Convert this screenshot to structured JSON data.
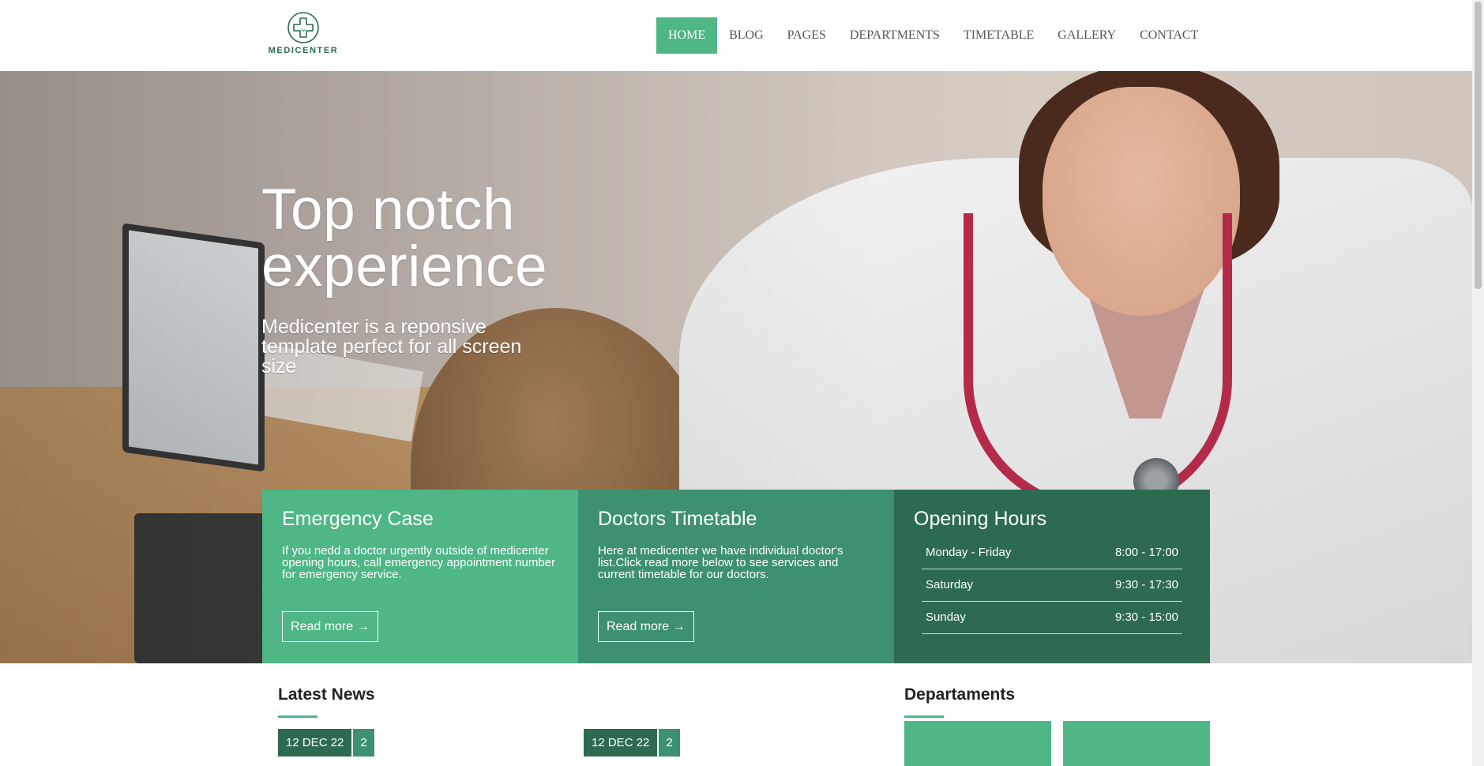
{
  "brand": {
    "logo_text": "MEDICENTER",
    "logo_icon": "medical-cross-icon",
    "accent_color": "#4fb785",
    "dark_color": "#2d6b51",
    "mid_color": "#3d9170"
  },
  "nav": {
    "items": [
      {
        "label": "HOME",
        "active": true
      },
      {
        "label": "BLOG",
        "active": false
      },
      {
        "label": "PAGES",
        "active": false
      },
      {
        "label": "DEPARTMENTS",
        "active": false
      },
      {
        "label": "TIMETABLE",
        "active": false
      },
      {
        "label": "GALLERY",
        "active": false
      },
      {
        "label": "CONTACT",
        "active": false
      }
    ]
  },
  "hero": {
    "title_line1": "Top notch",
    "title_line2": "experience",
    "subtitle": "Medicenter is a reponsive template perfect for all screen size"
  },
  "boxes": {
    "emergency": {
      "title": "Emergency Case",
      "text": "If you nedd a doctor urgently outside of medicenter opening hours, call emergency appointment number for emergency service.",
      "button": "Read more →"
    },
    "timetable": {
      "title": "Doctors Timetable",
      "text": "Here at medicenter we have individual doctor's list.Click read more below to see services and current timetable for our doctors.",
      "button": "Read more →"
    },
    "hours": {
      "title": "Opening Hours",
      "rows": [
        {
          "day": "Monday - Friday",
          "time": "8:00 - 17:00"
        },
        {
          "day": "Saturday",
          "time": "9:30 - 17:30"
        },
        {
          "day": "Sunday",
          "time": "9:30 - 15:00"
        }
      ]
    }
  },
  "news": {
    "title": "Latest News",
    "items": [
      {
        "date": "12 DEC 22",
        "comments": "2"
      },
      {
        "date": "12 DEC 22",
        "comments": "2"
      }
    ]
  },
  "departments": {
    "title": "Departaments"
  }
}
